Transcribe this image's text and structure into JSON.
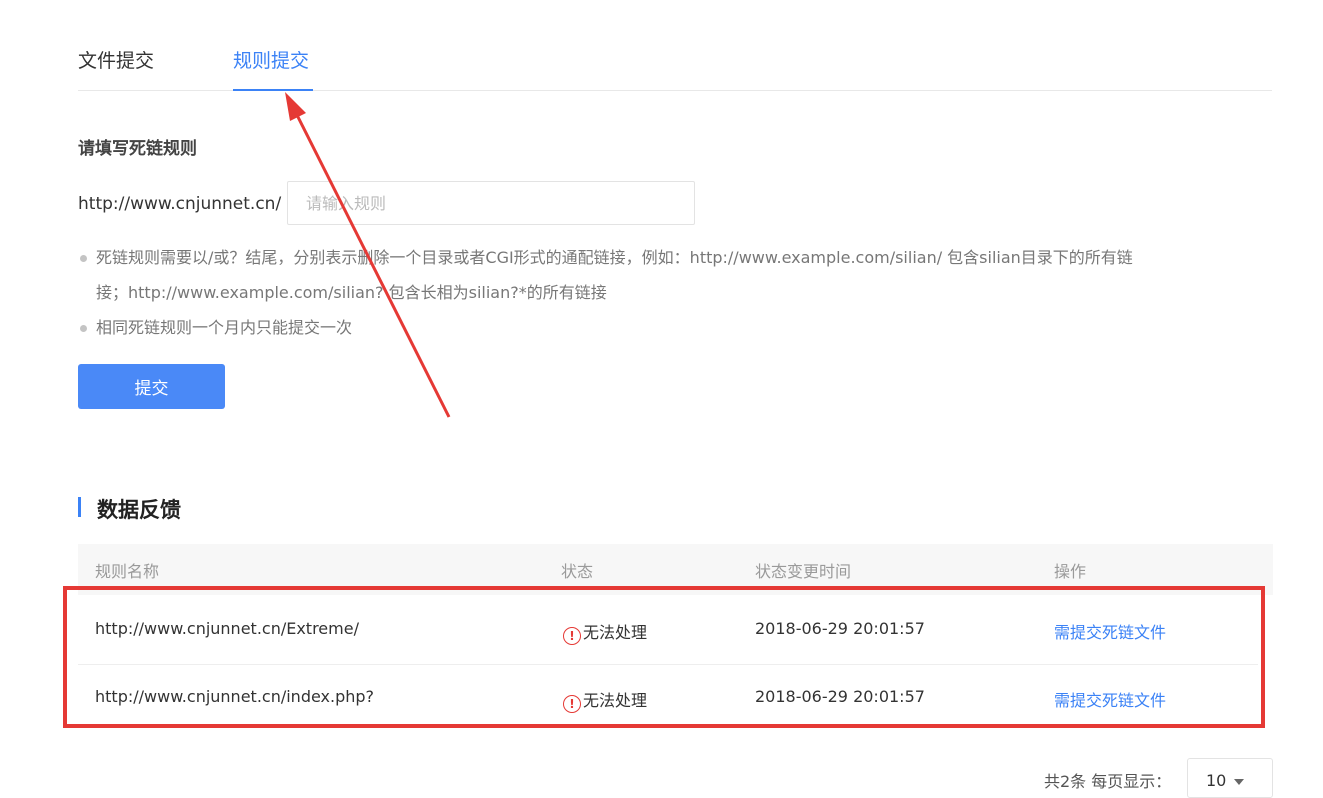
{
  "tabs": [
    {
      "label": "文件提交",
      "active": false
    },
    {
      "label": "规则提交",
      "active": true
    }
  ],
  "form": {
    "title": "请填写死链规则",
    "prefix": "http://www.cnjunnet.cn/",
    "input_value": "",
    "input_placeholder": "请输入规则",
    "notes": [
      "死链规则需要以/或？结尾，分别表示删除一个目录或者CGI形式的通配链接，例如：http://www.example.com/silian/ 包含silian目录下的所有链",
      "接；http://www.example.com/silian? 包含长相为silian?*的所有链接",
      "相同死链规则一个月内只能提交一次"
    ],
    "submit_label": "提交"
  },
  "feedback": {
    "title": "数据反馈",
    "columns": [
      "规则名称",
      "状态",
      "状态变更时间",
      "操作"
    ],
    "rows": [
      {
        "rule": "http://www.cnjunnet.cn/Extreme/",
        "status_icon": "!",
        "status": "无法处理",
        "time": "2018-06-29 20:01:57",
        "action": "需提交死链文件"
      },
      {
        "rule": "http://www.cnjunnet.cn/index.php?",
        "status_icon": "!",
        "status": "无法处理",
        "time": "2018-06-29 20:01:57",
        "action": "需提交死链文件"
      }
    ]
  },
  "pagination": {
    "summary": "共2条  每页显示：",
    "page_size": "10"
  },
  "colors": {
    "accent": "#3b82f6",
    "button": "#4a89f7",
    "annotation_red": "#e53935"
  }
}
